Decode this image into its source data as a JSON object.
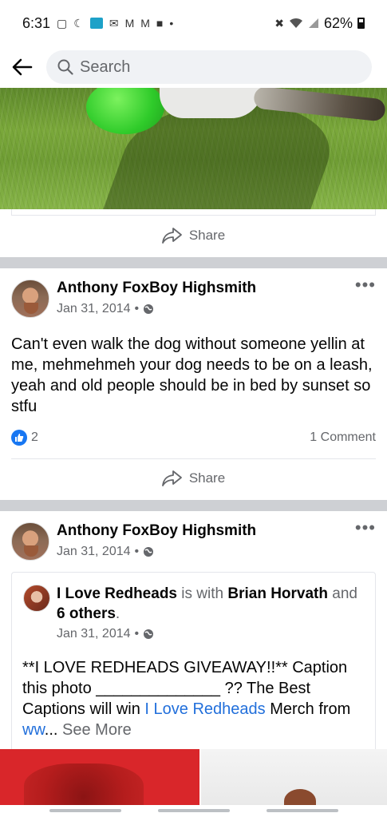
{
  "status_bar": {
    "time": "6:31",
    "battery": "62%",
    "icons": [
      "notification-icon",
      "moon-icon",
      "app-icon",
      "mail-icon",
      "gmail-icon",
      "person-icon",
      "dot-icon",
      "mute-icon",
      "wifi-icon",
      "signal-icon",
      "battery-icon"
    ]
  },
  "search": {
    "placeholder": "Search"
  },
  "feed": {
    "share_label": "Share",
    "post1": {
      "author": "Anthony FoxBoy Highsmith",
      "date": "Jan 31, 2014",
      "text": "Can't even walk the dog without someone yellin at me, mehmehmeh your dog needs to be on a leash, yeah and old people should be in bed by sunset so stfu",
      "reaction_count": "2",
      "comments": "1 Comment",
      "share_label": "Share"
    },
    "post2": {
      "author": "Anthony FoxBoy Highsmith",
      "date": "Jan 31, 2014",
      "shared": {
        "page": "I Love Redheads",
        "with_text": "is with",
        "tagged": "Brian Horvath",
        "and_text": "and",
        "others": "6 others",
        "period": ".",
        "date": "Jan 31, 2014",
        "text_part1": "**I LOVE REDHEADS GIVEAWAY!!** Caption this photo ______________ ?? The Best Captions will win",
        "link_text": "I Love Redheads",
        "text_part2": "Merch from",
        "link_tail": "ww",
        "ellipsis": "...",
        "see_more": "See More"
      }
    }
  },
  "colors": {
    "accent": "#1877f2",
    "link": "#216fdb",
    "divider": "#ced0d4",
    "secondary_text": "#65676b"
  }
}
